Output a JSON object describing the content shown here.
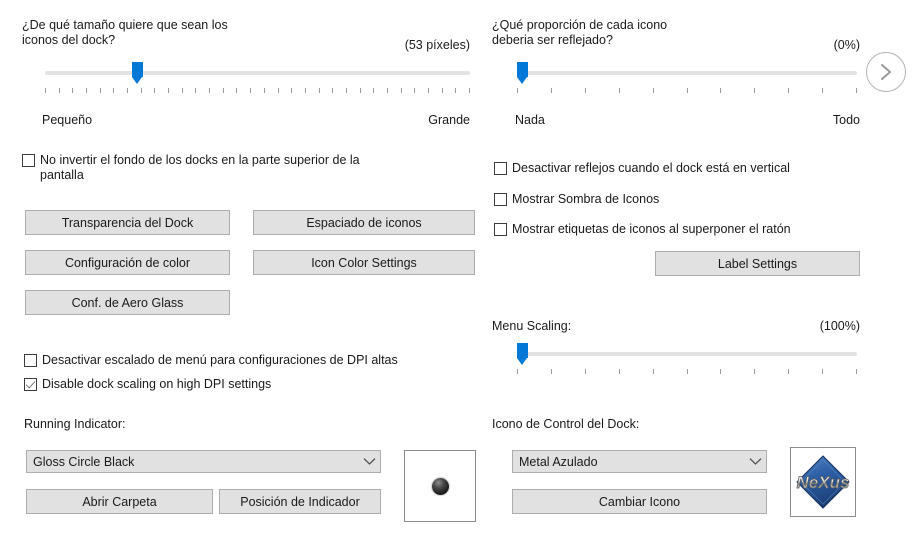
{
  "left_column": {
    "icon_size": {
      "question": "¿De qué tamaño quiere que sean los\niconos del dock?",
      "value": "(53 píxeles)",
      "min_label": "Pequeño",
      "max_label": "Grande",
      "thumb_percent": 21,
      "tick_count": 32
    },
    "no_invert_checkbox": {
      "label": "No invertir el fondo de los docks en la parte superior de la\npantalla",
      "checked": false
    },
    "buttons": [
      {
        "label": "Transparencia del Dock"
      },
      {
        "label": "Espaciado de iconos"
      },
      {
        "label": "Configuración de color"
      },
      {
        "label": "Icon Color Settings"
      },
      {
        "label": "Conf. de Aero Glass"
      }
    ],
    "dpi_checkboxes": [
      {
        "label": "Desactivar escalado de menú para configuraciones de DPI altas",
        "checked": false
      },
      {
        "label": "Disable dock scaling on high DPI settings",
        "checked": true
      }
    ],
    "running_indicator": {
      "title": "Running Indicator:",
      "selected": "Gloss Circle Black",
      "open_folder_button": "Abrir Carpeta",
      "position_button": "Posición de Indicador",
      "preview_icon": "gloss-circle-black-icon"
    }
  },
  "right_column": {
    "reflection": {
      "question": "¿Qué proporción de cada icono\ndeberia ser reflejado?",
      "value": "(0%)",
      "min_label": "Nada",
      "max_label": "Todo",
      "thumb_percent": 0,
      "tick_count": 11
    },
    "checkboxes": [
      {
        "label": "Desactivar reflejos cuando el dock está en vertical",
        "checked": false
      },
      {
        "label": "Mostrar Sombra de Iconos",
        "checked": false
      },
      {
        "label": "Mostrar etiquetas de iconos al superponer el ratón",
        "checked": false
      }
    ],
    "label_settings_button": "Label Settings",
    "menu_scaling": {
      "title": "Menu Scaling:",
      "value": "(100%)",
      "thumb_percent": 0,
      "tick_count": 11
    },
    "dock_control_icon": {
      "title": "Icono de Control del Dock:",
      "selected": "Metal Azulado",
      "change_button": "Cambiar Icono",
      "preview_icon": "nexus-logo-icon",
      "preview_text": "NeXus"
    }
  },
  "navigation": {
    "next_page_icon": "chevron-right-icon"
  },
  "colors": {
    "accent": "#0078d7",
    "button_face": "#e1e1e1",
    "button_border": "#adadad",
    "track": "#e3e3e3",
    "text": "#1a1a1a",
    "nexus_blue": "#2a5fa5"
  }
}
